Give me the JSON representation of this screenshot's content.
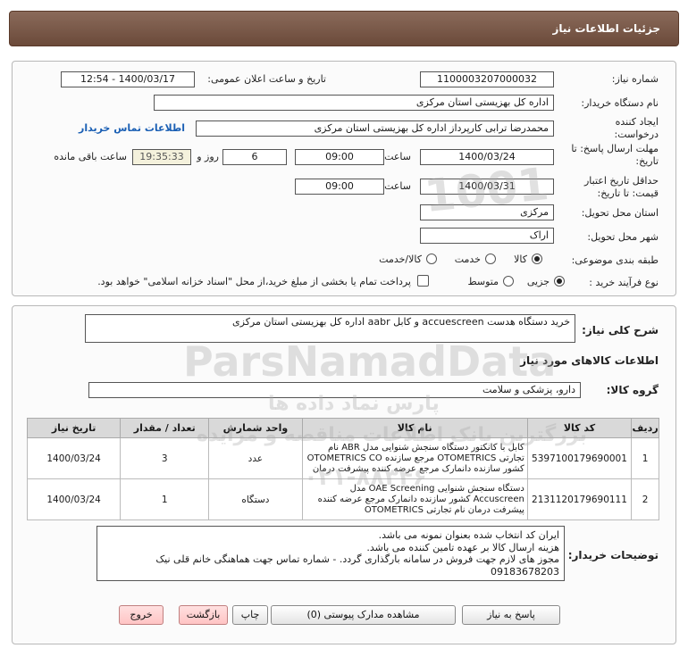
{
  "header": {
    "title": "جزئیات اطلاعات نیاز"
  },
  "info": {
    "need_number_label": "شماره نیاز:",
    "need_number": "1100003207000032",
    "announce_label": "تاریخ و ساعت اعلان عمومی:",
    "announce_value": "1400/03/17 - 12:54",
    "buyer_label": "نام دستگاه خریدار:",
    "buyer_value": "اداره کل بهزیستی استان مرکزی",
    "creator_label": "ایجاد کننده درخواست:",
    "creator_value": "محمدرضا ترابی کارپرداز اداره کل بهزیستی استان مرکزی",
    "contact_link": "اطلاعات تماس خریدار",
    "deadline_label": "مهلت ارسال پاسخ: تا تاریخ:",
    "deadline_date": "1400/03/24",
    "time_label": "ساعت",
    "deadline_time": "09:00",
    "days_value": "6",
    "days_label": "روز و",
    "remaining_time": "19:35:33",
    "remaining_label": "ساعت باقی مانده",
    "validity_label": "حداقل تاریخ اعتبار قیمت: تا تاریخ:",
    "validity_date": "1400/03/31",
    "validity_time": "09:00",
    "province_label": "استان محل تحویل:",
    "province_value": "مرکزی",
    "city_label": "شهر محل تحویل:",
    "city_value": "اراک",
    "category_label": "طبقه بندی موضوعی:",
    "category_options": [
      "کالا",
      "خدمت",
      "کالا/خدمت"
    ],
    "category_selected": "کالا",
    "process_label": "نوع فرآیند خرید :",
    "process_options": [
      "جزیی",
      "متوسط"
    ],
    "process_selected": "جزیی",
    "payment_note": "پرداخت تمام یا بخشی از مبلغ خرید،از محل \"اسناد خزانه اسلامی\" خواهد بود."
  },
  "summary": {
    "label": "شرح کلی نیاز:",
    "value": "خرید دستگاه هدست accuescreen  و کابل aabr اداره کل بهزیستی استان مرکزی"
  },
  "goods": {
    "section_title": "اطلاعات کالاهای مورد نیاز",
    "group_label": "گروه کالا:",
    "group_value": "دارو، پزشکی و سلامت",
    "columns": [
      "ردیف",
      "کد کالا",
      "نام کالا",
      "واحد شمارش",
      "تعداد / مقدار",
      "تاریخ نیاز"
    ],
    "rows": [
      {
        "index": "1",
        "code": "5397100179690001",
        "name": "کابل با کانکتور دستگاه سنجش شنوایی مدل ABR نام تجارتی OTOMETRICS مرجع سازنده OTOMETRICS CO کشور سازنده دانمارک مرجع عرضه کننده پیشرفت درمان",
        "unit": "عدد",
        "qty": "3",
        "date": "1400/03/24"
      },
      {
        "index": "2",
        "code": "2131120179690111",
        "name": "دستگاه سنجش شنوایی OAE Screening مدل Accuscreen کشور سازنده دانمارک مرجع عرضه کننده پیشرفت درمان نام تجارتی OTOMETRICS",
        "unit": "دستگاه",
        "qty": "1",
        "date": "1400/03/24"
      }
    ]
  },
  "buyer_notes": {
    "label": "توضیحات خریدار:",
    "lines": [
      "ایران کد انتخاب شده بعنوان نمونه می باشد.",
      "هزینه ارسال کالا بر عهده تامین کننده می باشد.",
      "مجوز های لازم جهت فروش در سامانه بارگذاری گردد. - شماره تماس جهت هماهنگی خانم قلی نیک",
      "09183678203"
    ]
  },
  "buttons": {
    "reply": "پاسخ به نیاز",
    "docs": "مشاهده مدارک پیوستی (0)",
    "print": "چاپ",
    "back": "بازگشت",
    "exit": "خروج"
  },
  "watermark": {
    "brand": "ParsNamadData",
    "tagline": "پارس نماد داده ها",
    "tagline2": "بزرگترین بانک اطلاعات مناقصه و مزایده",
    "phone": "۰۲۱-۸۸۳۴۶",
    "digits": "1001"
  }
}
